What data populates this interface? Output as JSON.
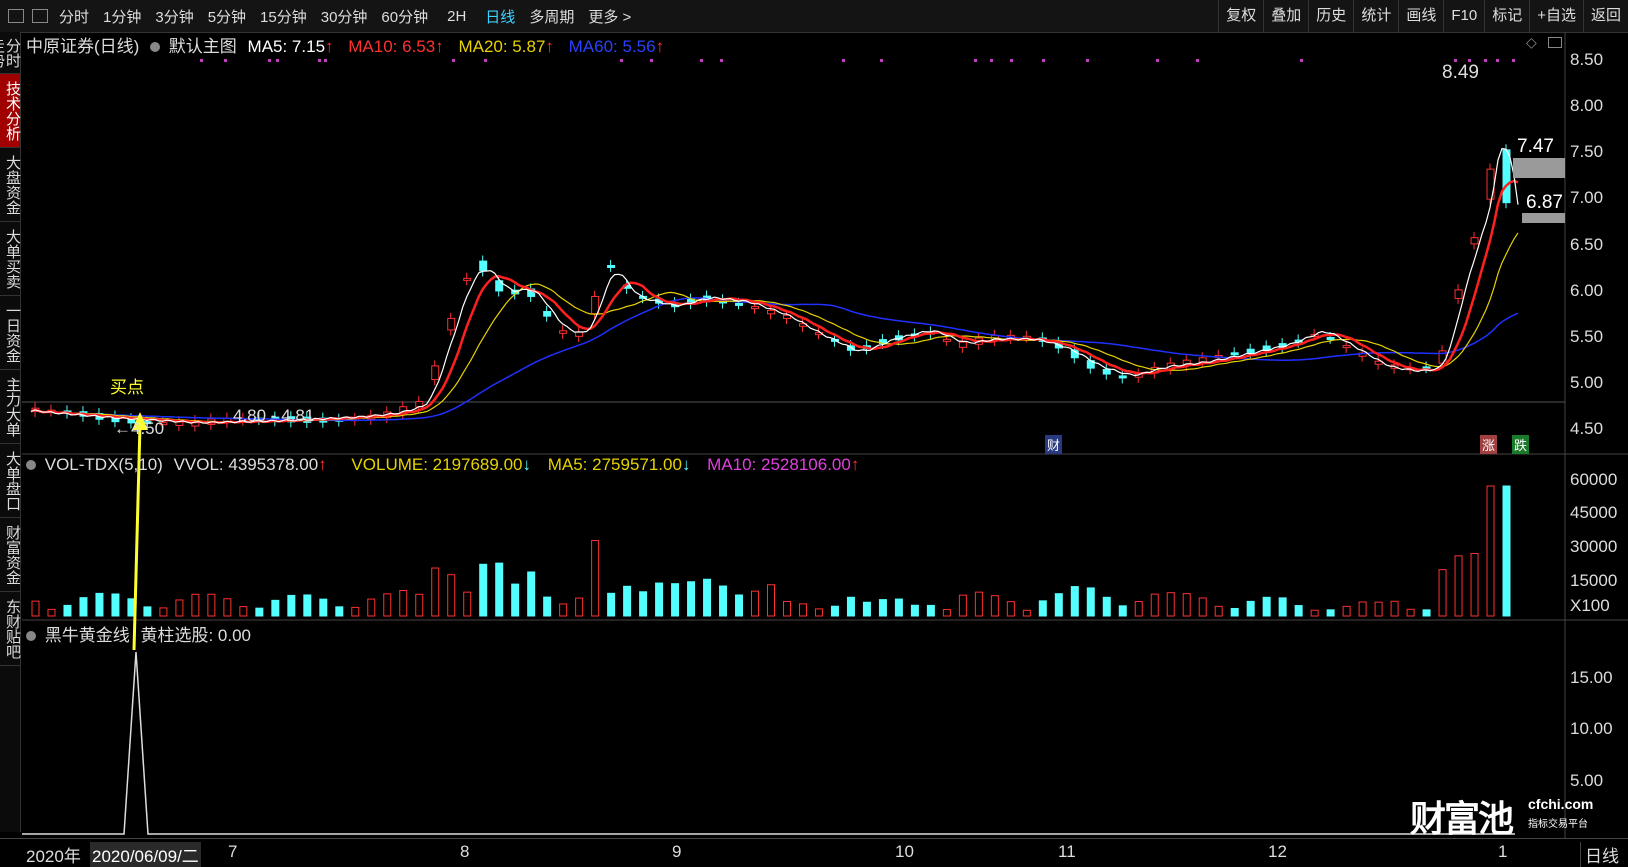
{
  "toolbar": {
    "tabs": [
      "分时",
      "1分钟",
      "3分钟",
      "5分钟",
      "15分钟",
      "30分钟",
      "60分钟",
      "2H",
      "日线",
      "多周期",
      "更多 >"
    ],
    "active_tab": "日线",
    "right_tabs": [
      "复权",
      "叠加",
      "历史",
      "统计",
      "画线",
      "F10",
      "标记",
      "+自选",
      "返回"
    ]
  },
  "sidebar": {
    "items": [
      "分时走势",
      "技术分析",
      "大盘资金",
      "大单买卖",
      "一日资金",
      "主力大单",
      "大单盘口",
      "财富资金",
      "东财贴吧"
    ],
    "active": "技术分析"
  },
  "main_chart": {
    "stock": "中原证券(日线)",
    "template": "默认主图",
    "ma5": "MA5: 7.15",
    "ma10": "MA10: 6.53",
    "ma20": "MA20: 5.87",
    "ma60": "MA60: 5.56",
    "arrow": "↑",
    "annotations": {
      "high": "8.49",
      "low": "4.50",
      "low_arrow": "←",
      "range": "4.80 - 4.81",
      "buy_point": "买点",
      "price_747": "7.47",
      "price_687": "6.87",
      "cai_marker": "财",
      "zhang_marker": "涨",
      "die_marker": "跌"
    },
    "y_axis": [
      "8.50",
      "8.00",
      "7.50",
      "7.00",
      "6.50",
      "6.00",
      "5.50",
      "5.00",
      "4.50"
    ],
    "colors": {
      "ma5": "#ffffff",
      "ma10": "#ff2020",
      "ma20": "#e6d200",
      "ma60": "#2030ff",
      "up": "#ff3030",
      "down": "#54ffff"
    }
  },
  "volume_chart": {
    "name": "VOL-TDX(5,10)",
    "vvol": "VVOL: 4395378.00",
    "volume": "VOLUME: 2197689.00",
    "ma5": "MA5: 2759571.00",
    "ma10": "MA10: 2528106.00",
    "up_arrow": "↑",
    "down_arrow": "↓",
    "y_axis": [
      "60000",
      "45000",
      "30000",
      "15000"
    ],
    "unit": "X100"
  },
  "indicator_chart": {
    "name": "黑牛黄金线",
    "label": "黄柱选股: 0.00",
    "y_axis": [
      "15.00",
      "10.00",
      "5.00"
    ]
  },
  "x_axis": {
    "year": "2020年",
    "cursor_date": "2020/06/09/二",
    "months": [
      "7",
      "8",
      "9",
      "10",
      "11",
      "12",
      "1"
    ],
    "period": "日线"
  },
  "watermark": {
    "logo": "财富池",
    "domain": "cfchi.com",
    "slogan": "指标交易平台"
  }
}
